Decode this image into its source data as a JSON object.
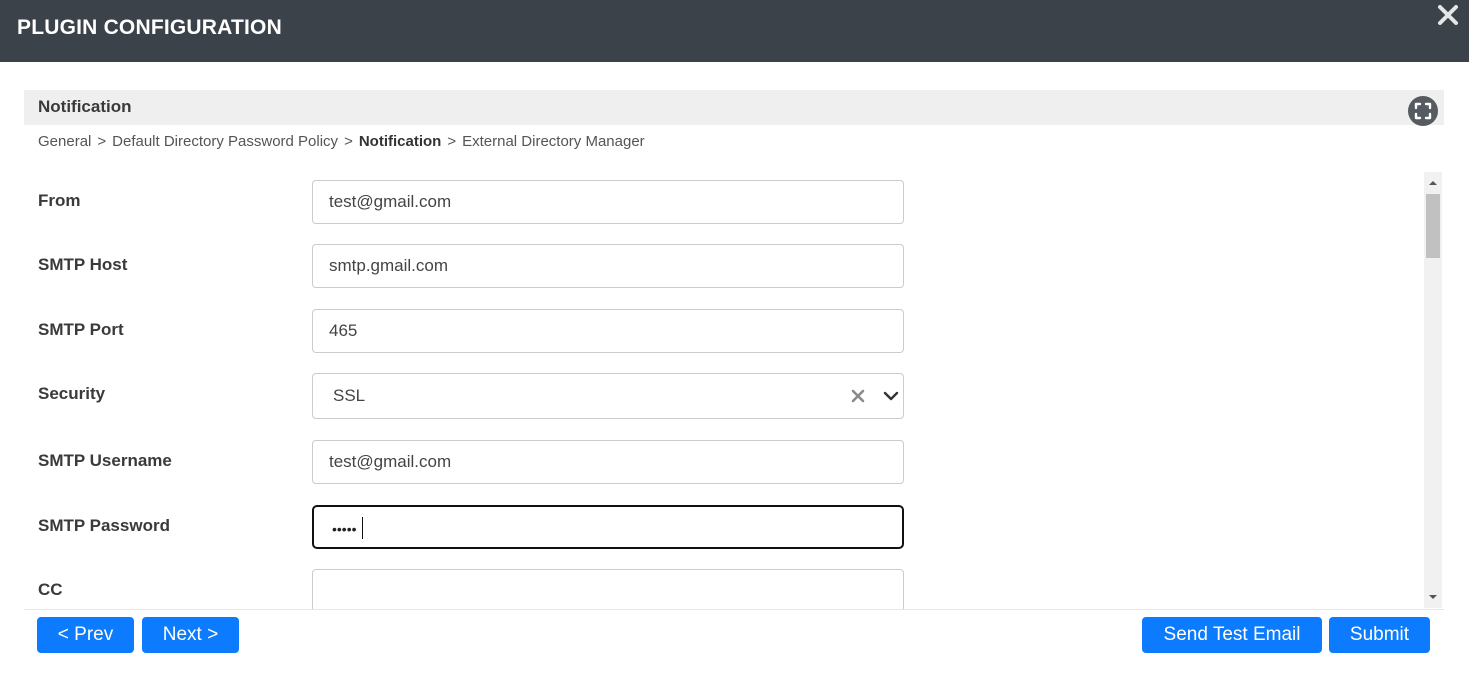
{
  "dialog": {
    "title": "PLUGIN CONFIGURATION"
  },
  "section": {
    "title": "Notification"
  },
  "breadcrumb": {
    "items": [
      "General",
      "Default Directory Password Policy",
      "Notification",
      "External Directory Manager"
    ],
    "separator": ">",
    "current_index": 2
  },
  "form": {
    "from": {
      "label": "From",
      "value": "test@gmail.com"
    },
    "smtp_host": {
      "label": "SMTP Host",
      "value": "smtp.gmail.com"
    },
    "smtp_port": {
      "label": "SMTP Port",
      "value": "465"
    },
    "security": {
      "label": "Security",
      "value": "SSL"
    },
    "smtp_username": {
      "label": "SMTP Username",
      "value": "test@gmail.com"
    },
    "smtp_password": {
      "label": "SMTP Password",
      "value": "•••••"
    },
    "cc": {
      "label": "CC",
      "value": ""
    }
  },
  "buttons": {
    "prev": "< Prev",
    "next": "Next >",
    "send_test_email": "Send Test Email",
    "submit": "Submit"
  },
  "colors": {
    "titlebar": "#3c4249",
    "primary_button": "#0d7bfd",
    "section_header": "#efefef"
  },
  "icons": {
    "close": "close-icon",
    "expand": "fullscreen-icon",
    "select_clear": "clear-icon",
    "select_open": "chevron-down-icon"
  }
}
